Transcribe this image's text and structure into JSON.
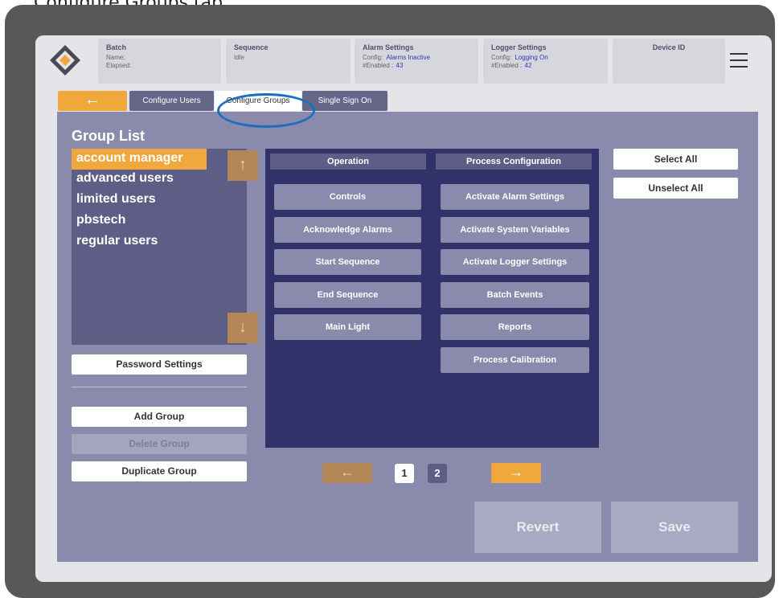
{
  "caption": "Configure Groups tab",
  "header": {
    "batch": {
      "title": "Batch",
      "name_label": "Name:",
      "elapsed_label": "Elapsed:"
    },
    "sequence": {
      "title": "Sequence",
      "status": "Idle"
    },
    "alarm": {
      "title": "Alarm Settings",
      "config_label": "Config:",
      "config_value": "Alarms Inactive",
      "enabled_label": "#Enabled :",
      "enabled_value": "43"
    },
    "logger": {
      "title": "Logger Settings",
      "config_label": "Config:",
      "config_value": "Logging On",
      "enabled_label": "#Enabled :",
      "enabled_value": "42"
    },
    "device": {
      "title": "Device ID"
    }
  },
  "nav": {
    "back_icon": "←",
    "tabs": [
      {
        "label": "Configure Users"
      },
      {
        "label": "Configure Groups"
      },
      {
        "label": "Single Sign On"
      }
    ]
  },
  "groups": {
    "title": "Group List",
    "items": [
      {
        "label": "account manager"
      },
      {
        "label": "advanced users"
      },
      {
        "label": "limited users"
      },
      {
        "label": "pbstech"
      },
      {
        "label": "regular users"
      }
    ],
    "up_icon": "↑",
    "down_icon": "↓"
  },
  "side_buttons": {
    "password": "Password Settings",
    "add": "Add Group",
    "delete": "Delete Group",
    "duplicate": "Duplicate Group"
  },
  "operation": {
    "header": "Operation",
    "items": [
      {
        "label": "Controls"
      },
      {
        "label": "Acknowledge Alarms"
      },
      {
        "label": "Start Sequence"
      },
      {
        "label": "End Sequence"
      },
      {
        "label": "Main Light"
      }
    ]
  },
  "process": {
    "header": "Process Configuration",
    "items": [
      {
        "label": "Activate Alarm Settings"
      },
      {
        "label": "Activate System Variables"
      },
      {
        "label": "Activate Logger Settings"
      },
      {
        "label": "Batch Events"
      },
      {
        "label": "Reports"
      },
      {
        "label": "Process Calibration"
      }
    ]
  },
  "selection": {
    "select_all": "Select All",
    "unselect_all": "Unselect All"
  },
  "pagination": {
    "prev_icon": "←",
    "next_icon": "→",
    "pages": [
      "1",
      "2"
    ]
  },
  "actions": {
    "revert": "Revert",
    "save": "Save"
  },
  "colors": {
    "accent": "#f0a83c",
    "panel": "#8a8aac",
    "dark": "#32326a",
    "highlight": "#1a6fbf"
  }
}
